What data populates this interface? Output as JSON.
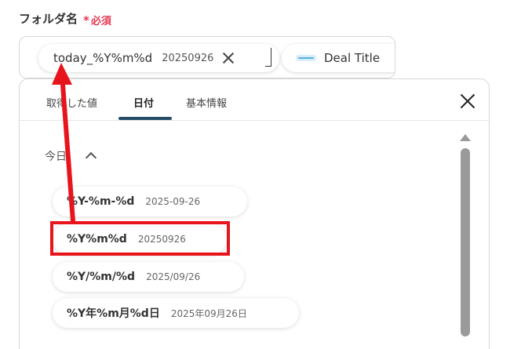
{
  "form": {
    "label": "フォルダ名",
    "required_mark": "*",
    "required_text": "必須",
    "value_chips": [
      {
        "label": "today_%Y%m%d",
        "value": "20250926"
      },
      {
        "label": "Deal Title",
        "logo": "app-logo"
      }
    ]
  },
  "picker": {
    "tabs": [
      {
        "label": "取得した値",
        "active": false
      },
      {
        "label": "日付",
        "active": true
      },
      {
        "label": "基本情報",
        "active": false
      }
    ],
    "section_title": "今日",
    "options": [
      {
        "format": "%Y-%m-%d",
        "example": "2025-09-26"
      },
      {
        "format": "%Y%m%d",
        "example": "20250926",
        "highlighted": true
      },
      {
        "format": "%Y/%m/%d",
        "example": "2025/09/26"
      },
      {
        "format": "%Y年%m月%d日",
        "example": "2025年09月26日"
      }
    ]
  },
  "annotation": {
    "color": "#e8141c"
  },
  "colors": {
    "required": "#e23b55",
    "tab_underline": "#244c66"
  }
}
